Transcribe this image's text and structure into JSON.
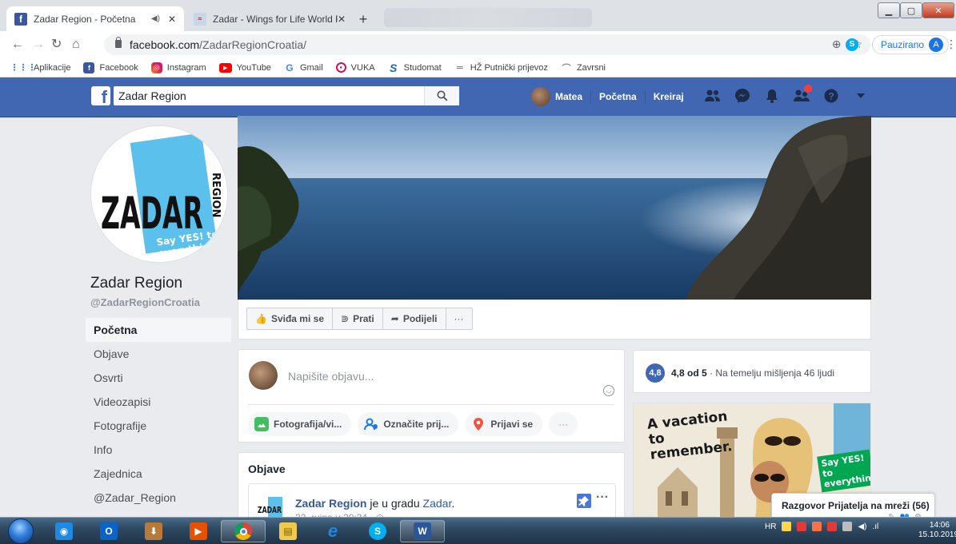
{
  "browser": {
    "tabs": [
      {
        "title": "Zadar Region - Početna",
        "active": true
      },
      {
        "title": "Zadar - Wings for Life World Run",
        "active": false
      }
    ],
    "url_domain": "facebook.com",
    "url_path": "/ZadarRegionCroatia/",
    "profile_label": "Pauzirano",
    "profile_initial": "A",
    "bookmarks": [
      "Aplikacije",
      "Facebook",
      "Instagram",
      "YouTube",
      "Gmail",
      "VUKA",
      "Studomat",
      "HŽ Putnički prijevoz",
      "Zavrsni"
    ]
  },
  "fb_header": {
    "search_value": "Zadar Region",
    "user_name": "Matea",
    "home_label": "Početna",
    "create_label": "Kreiraj"
  },
  "page": {
    "name": "Zadar Region",
    "handle": "@ZadarRegionCroatia",
    "logo_text": "ZADAR",
    "logo_sub": "REGION",
    "logo_slogan": "Say YES! to everything",
    "nav": [
      "Početna",
      "Objave",
      "Osvrti",
      "Videozapisi",
      "Fotografije",
      "Info",
      "Zajednica",
      "@Zadar_Region"
    ],
    "actions": {
      "like": "Sviđa mi se",
      "follow": "Prati",
      "share": "Podijeli",
      "more": "···"
    }
  },
  "composer": {
    "placeholder": "Napišite objavu...",
    "photo": "Fotografija/vi...",
    "tag": "Označite prij...",
    "checkin": "Prijavi se",
    "more": "···"
  },
  "posts": {
    "title": "Objave",
    "first": {
      "author": "Zadar Region",
      "action": " je u gradu ",
      "place": "Zadar",
      "date": "22. rujna u 20:34 ·"
    }
  },
  "rating": {
    "score": "4,8",
    "summary": "4,8 od 5",
    "detail": " · Na temelju mišljenja 46 ljudi"
  },
  "ad": {
    "headline": "A vacation to remember.",
    "slogan": "Say YES! to everything"
  },
  "chat": {
    "label": "Razgovor Prijatelja na mreži (56)"
  },
  "taskbar": {
    "lang": "HR",
    "time": "14:06",
    "date": "15.10.2019."
  },
  "colors": {
    "fb_blue": "#4267b2",
    "zadar_blue": "#5bc0eb",
    "chrome_blue": "#1a73e8"
  }
}
